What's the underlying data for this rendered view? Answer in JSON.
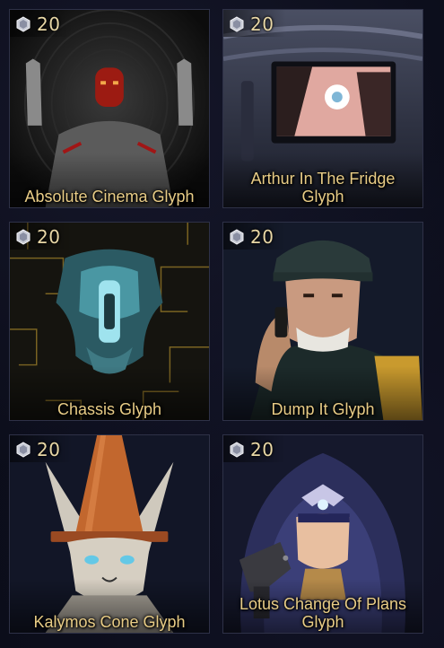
{
  "items": [
    {
      "name": "Absolute Cinema Glyph",
      "price": "20",
      "icon": "platinum-icon"
    },
    {
      "name": "Arthur In The Fridge Glyph",
      "price": "20",
      "icon": "platinum-icon"
    },
    {
      "name": "Chassis Glyph",
      "price": "20",
      "icon": "platinum-icon"
    },
    {
      "name": "Dump It Glyph",
      "price": "20",
      "icon": "platinum-icon"
    },
    {
      "name": "Kalymos Cone Glyph",
      "price": "20",
      "icon": "platinum-icon"
    },
    {
      "name": "Lotus Change Of Plans Glyph",
      "price": "20",
      "icon": "platinum-icon"
    }
  ],
  "colors": {
    "name_text": "#e8cc86",
    "price_text": "#e8d7a6",
    "tile_border": "#2e3147",
    "background": "#0b0d1a"
  }
}
